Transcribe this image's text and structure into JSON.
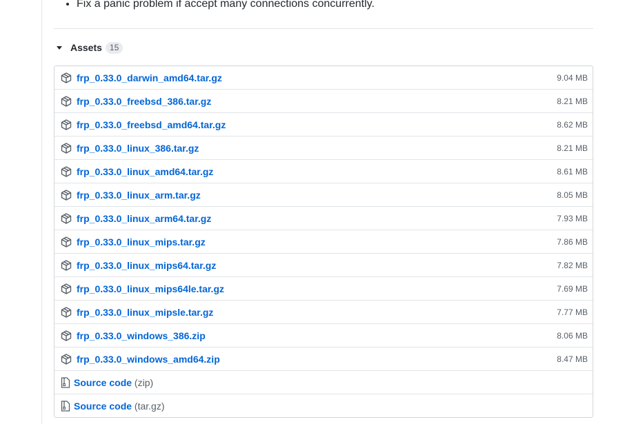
{
  "release_notes": {
    "items": [
      "Fix a panic problem if accept many connections concurrently."
    ]
  },
  "assets": {
    "title": "Assets",
    "count": "15",
    "files": [
      {
        "name": "frp_0.33.0_darwin_amd64.tar.gz",
        "size": "9.04 MB"
      },
      {
        "name": "frp_0.33.0_freebsd_386.tar.gz",
        "size": "8.21 MB"
      },
      {
        "name": "frp_0.33.0_freebsd_amd64.tar.gz",
        "size": "8.62 MB"
      },
      {
        "name": "frp_0.33.0_linux_386.tar.gz",
        "size": "8.21 MB"
      },
      {
        "name": "frp_0.33.0_linux_amd64.tar.gz",
        "size": "8.61 MB"
      },
      {
        "name": "frp_0.33.0_linux_arm.tar.gz",
        "size": "8.05 MB"
      },
      {
        "name": "frp_0.33.0_linux_arm64.tar.gz",
        "size": "7.93 MB"
      },
      {
        "name": "frp_0.33.0_linux_mips.tar.gz",
        "size": "7.86 MB"
      },
      {
        "name": "frp_0.33.0_linux_mips64.tar.gz",
        "size": "7.82 MB"
      },
      {
        "name": "frp_0.33.0_linux_mips64le.tar.gz",
        "size": "7.69 MB"
      },
      {
        "name": "frp_0.33.0_linux_mipsle.tar.gz",
        "size": "7.77 MB"
      },
      {
        "name": "frp_0.33.0_windows_386.zip",
        "size": "8.06 MB"
      },
      {
        "name": "frp_0.33.0_windows_amd64.zip",
        "size": "8.47 MB"
      }
    ],
    "source": [
      {
        "label": "Source code",
        "suffix": "(zip)"
      },
      {
        "label": "Source code",
        "suffix": "(tar.gz)"
      }
    ],
    "icons": {
      "file": "package-icon",
      "source": "file-zip-icon"
    }
  },
  "colors": {
    "link": "#0366d6",
    "muted": "#586069",
    "border": "#d1d5da"
  }
}
